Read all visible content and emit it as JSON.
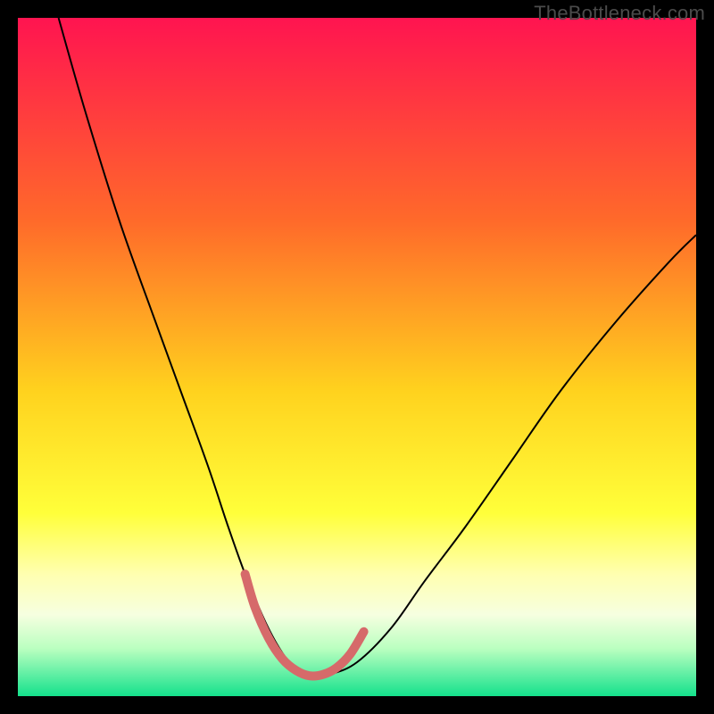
{
  "watermark": "TheBottleneck.com",
  "chart_data": {
    "type": "line",
    "title": "",
    "xlabel": "",
    "ylabel": "",
    "xlim": [
      0,
      100
    ],
    "ylim": [
      0,
      100
    ],
    "gradient_stops": [
      {
        "offset": 0,
        "color": "#ff1450"
      },
      {
        "offset": 30,
        "color": "#ff6a2a"
      },
      {
        "offset": 55,
        "color": "#ffd21e"
      },
      {
        "offset": 73,
        "color": "#ffff3a"
      },
      {
        "offset": 82,
        "color": "#ffffb0"
      },
      {
        "offset": 88,
        "color": "#f6ffe0"
      },
      {
        "offset": 93,
        "color": "#baffc0"
      },
      {
        "offset": 100,
        "color": "#14e18c"
      }
    ],
    "series": [
      {
        "name": "bottleneck-curve",
        "color": "#000000",
        "width": 2,
        "x": [
          6,
          10,
          15,
          20,
          24,
          28,
          31,
          33.5,
          36,
          38,
          40,
          42,
          44,
          46,
          50,
          55,
          60,
          66,
          73,
          80,
          88,
          96,
          100
        ],
        "y": [
          100,
          86,
          70,
          56,
          45,
          34,
          25,
          18,
          12,
          8,
          5,
          3.2,
          3,
          3.2,
          5,
          10,
          17,
          25,
          35,
          45,
          55,
          64,
          68
        ]
      },
      {
        "name": "highlight-band",
        "color": "#d66a6a",
        "width": 10,
        "x": [
          33.5,
          35,
          37,
          39,
          41,
          43,
          45,
          47,
          49,
          51
        ],
        "y": [
          18,
          13,
          8.5,
          5.5,
          3.8,
          3,
          3.2,
          4.2,
          6.2,
          9.5
        ]
      }
    ]
  }
}
